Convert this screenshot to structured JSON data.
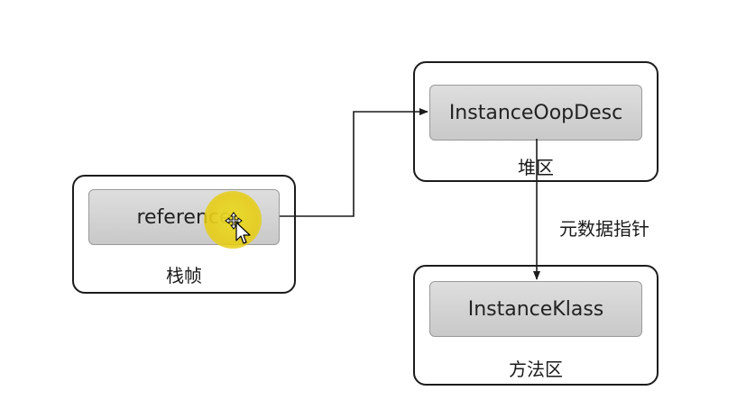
{
  "diagram": {
    "stack_frame": {
      "cell_label": "reference",
      "caption": "栈帧"
    },
    "heap": {
      "cell_label": "InstanceOopDesc",
      "caption": "堆区"
    },
    "method_area": {
      "cell_label": "InstanceKlass",
      "caption": "方法区"
    },
    "edge_label": "元数据指针"
  },
  "icons": {
    "cursor": "mouse-pointer-icon",
    "move_cursor": "move-cursor-icon"
  },
  "colors": {
    "cursor_highlight": "#e8d21e",
    "cell_fill": "#d4d4d4",
    "border": "#1c1c1c"
  }
}
